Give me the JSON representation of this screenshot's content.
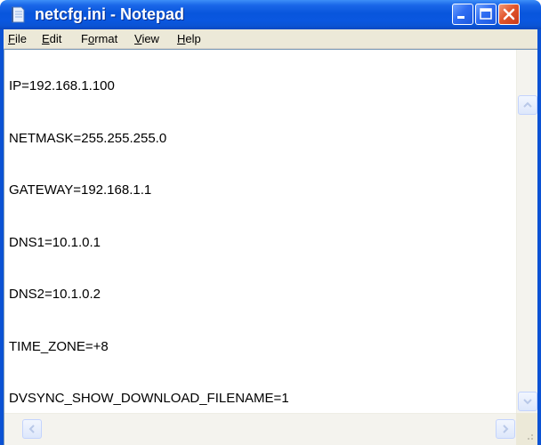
{
  "window": {
    "title": "netcfg.ini - Notepad",
    "title_icon": "notepad-icon",
    "controls": [
      "minimize-icon",
      "maximize-icon",
      "close-icon"
    ]
  },
  "menu": {
    "items": [
      {
        "label": "File",
        "ul": "F",
        "rest": "ile"
      },
      {
        "label": "Edit",
        "ul": "E",
        "rest": "dit"
      },
      {
        "label": "Format",
        "ul": "o",
        "pre": "F",
        "rest": "rmat"
      },
      {
        "label": "View",
        "ul": "V",
        "rest": "iew"
      },
      {
        "label": "Help",
        "ul": "H",
        "rest": "elp"
      }
    ]
  },
  "document": {
    "lines": [
      "IP=192.168.1.100",
      "NETMASK=255.255.255.0",
      "GATEWAY=192.168.1.1",
      "DNS1=10.1.0.1",
      "DNS2=10.1.0.2",
      "TIME_ZONE=+8",
      "DVSYNC_SHOW_DOWNLOAD_FILENAME=1"
    ]
  },
  "scrollbars": {
    "vertical_icons": [
      "scroll-up-icon",
      "scroll-down-icon"
    ],
    "horizontal_icons": [
      "scroll-left-icon",
      "scroll-right-icon"
    ]
  },
  "colors": {
    "titlebar": "#0856dc",
    "menubar": "#ece9d8",
    "close": "#e2562c"
  }
}
